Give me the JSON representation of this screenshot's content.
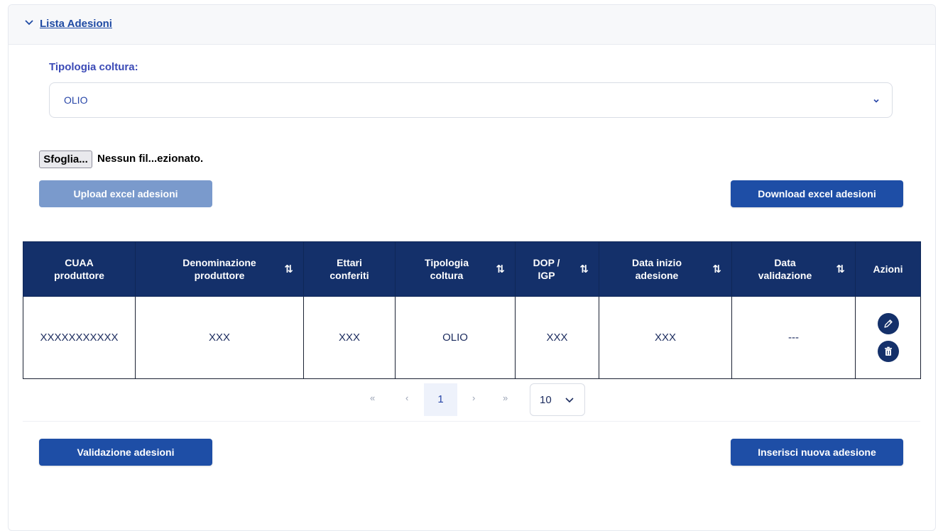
{
  "panel": {
    "title": "Lista Adesioni",
    "colors": {
      "primary": "#1e4ea6",
      "table_header": "#14306a",
      "disabled": "#7a9acc"
    }
  },
  "filter": {
    "label": "Tipologia coltura:",
    "selected": "OLIO"
  },
  "file_input": {
    "button_label": "Sfoglia...",
    "file_name": "Nessun fil...ezionato."
  },
  "buttons": {
    "upload": "Upload excel adesioni",
    "download": "Download excel adesioni",
    "validate": "Validazione adesioni",
    "insert": "Inserisci nuova adesione"
  },
  "table": {
    "columns": [
      {
        "line1": "CUAA",
        "line2": "produttore",
        "sortable": false
      },
      {
        "line1": "Denominazione",
        "line2": "produttore",
        "sortable": true
      },
      {
        "line1": "Ettari",
        "line2": "conferiti",
        "sortable": false
      },
      {
        "line1": "Tipologia",
        "line2": "coltura",
        "sortable": true
      },
      {
        "line1": "DOP /",
        "line2": "IGP",
        "sortable": true
      },
      {
        "line1": "Data inizio",
        "line2": "adesione",
        "sortable": true
      },
      {
        "line1": "Data",
        "line2": "validazione",
        "sortable": true
      },
      {
        "line1": "Azioni",
        "line2": "",
        "sortable": false
      }
    ],
    "sort_icon": "⇅",
    "rows": [
      {
        "cuaa": "XXXXXXXXXXX",
        "denominazione": "XXX",
        "ettari": "XXX",
        "tipologia": "OLIO",
        "dop_igp": "XXX",
        "data_inizio": "XXX",
        "data_validazione": "---",
        "actions": [
          "edit-icon",
          "delete-icon"
        ]
      }
    ]
  },
  "pagination": {
    "first": "«",
    "prev": "‹",
    "current_page": "1",
    "next": "›",
    "last": "»",
    "page_size": "10"
  }
}
